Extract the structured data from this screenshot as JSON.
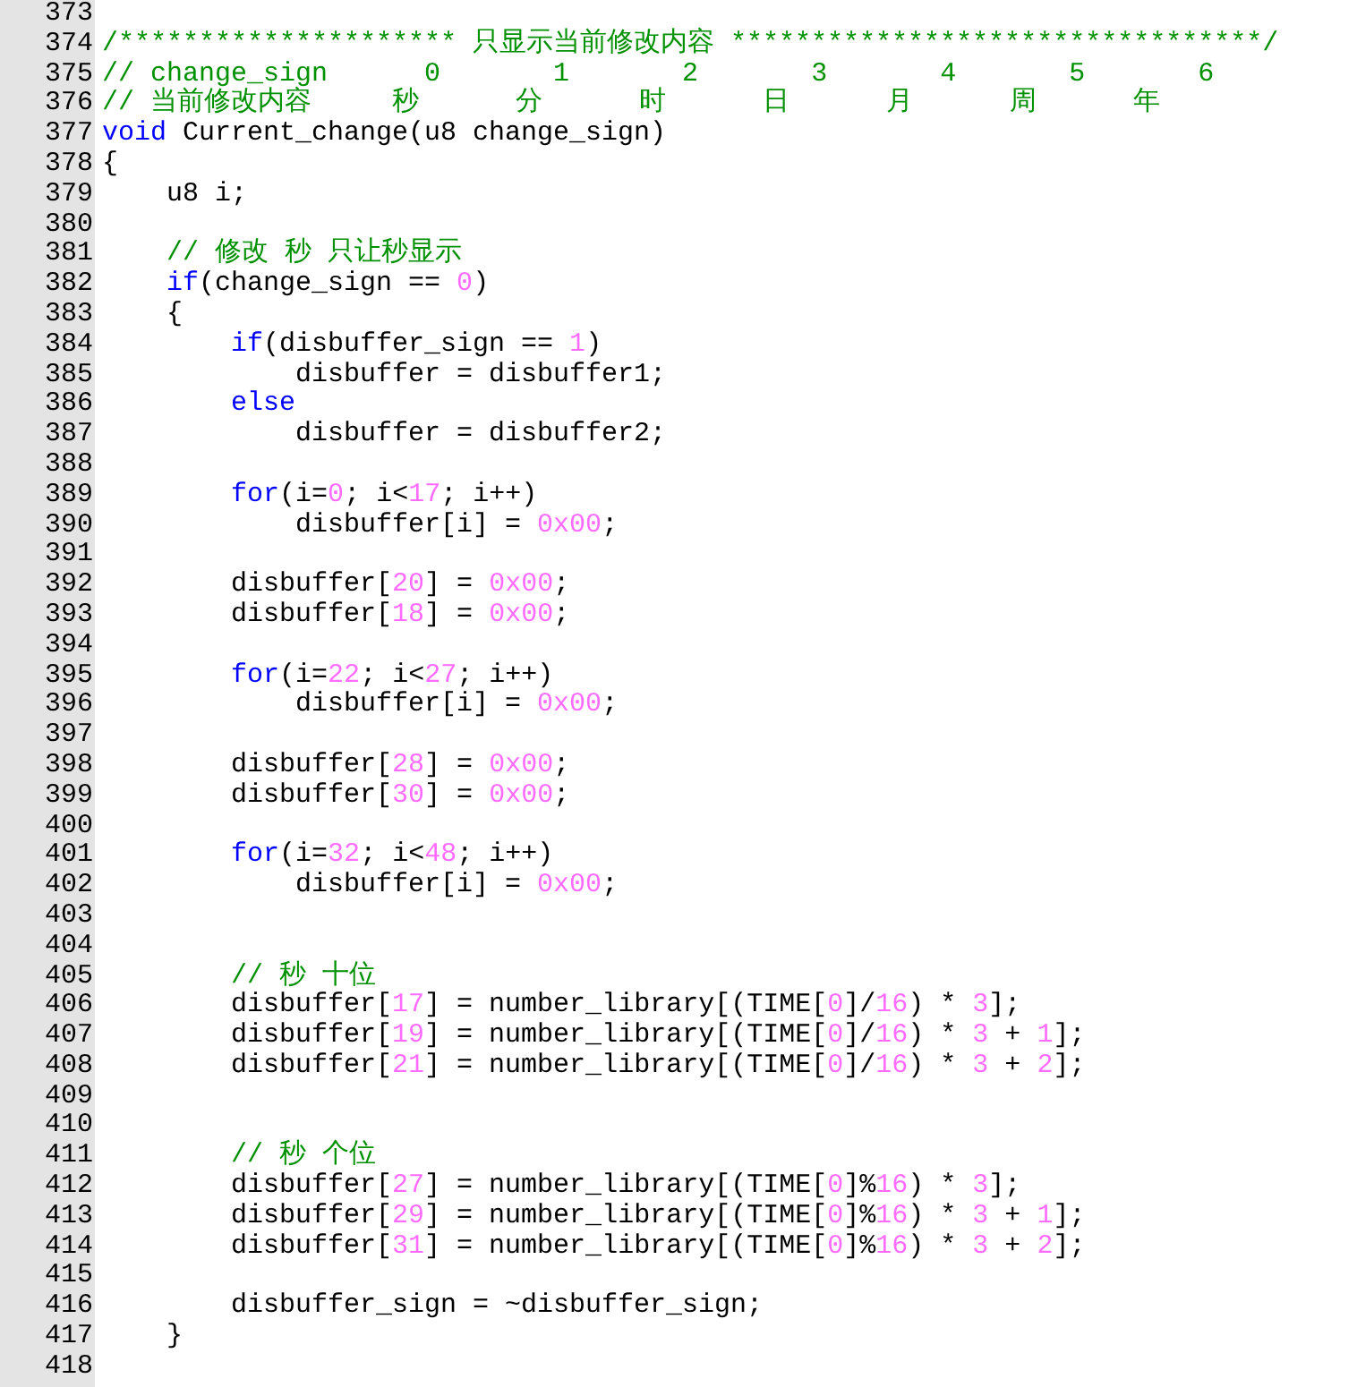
{
  "editor": {
    "lines": [
      {
        "number": "373"
      },
      {
        "number": "374",
        "tokens": [
          {
            "kind": "comment",
            "text": "/********************* 只显示当前修改内容 *********************************/"
          }
        ]
      },
      {
        "number": "375",
        "tokens": [
          {
            "kind": "comment",
            "text": "// change_sign      0       1       2       3       4       5       6"
          }
        ]
      },
      {
        "number": "376",
        "tokens": [
          {
            "kind": "comment",
            "text": "// 当前修改内容     秒      分      时      日      月      周      年"
          }
        ]
      },
      {
        "number": "377",
        "tokens": [
          {
            "kind": "keyword",
            "text": "void"
          },
          {
            "kind": "plain",
            "text": " Current_change(u8 change_sign)"
          }
        ]
      },
      {
        "number": "378",
        "tokens": [
          {
            "kind": "plain",
            "text": "{"
          }
        ]
      },
      {
        "number": "379",
        "tokens": [
          {
            "kind": "plain",
            "text": "    u8 i;"
          }
        ]
      },
      {
        "number": "380"
      },
      {
        "number": "381",
        "tokens": [
          {
            "kind": "comment",
            "text": "    // 修改 秒 只让秒显示"
          }
        ]
      },
      {
        "number": "382",
        "tokens": [
          {
            "kind": "keyword",
            "text": "    if"
          },
          {
            "kind": "plain",
            "text": "(change_sign == "
          },
          {
            "kind": "number",
            "text": "0"
          },
          {
            "kind": "plain",
            "text": ")"
          }
        ]
      },
      {
        "number": "383",
        "tokens": [
          {
            "kind": "plain",
            "text": "    {"
          }
        ]
      },
      {
        "number": "384",
        "tokens": [
          {
            "kind": "keyword",
            "text": "        if"
          },
          {
            "kind": "plain",
            "text": "(disbuffer_sign == "
          },
          {
            "kind": "number",
            "text": "1"
          },
          {
            "kind": "plain",
            "text": ")"
          }
        ]
      },
      {
        "number": "385",
        "tokens": [
          {
            "kind": "plain",
            "text": "            disbuffer = disbuffer1;"
          }
        ]
      },
      {
        "number": "386",
        "tokens": [
          {
            "kind": "keyword",
            "text": "        else"
          }
        ]
      },
      {
        "number": "387",
        "tokens": [
          {
            "kind": "plain",
            "text": "            disbuffer = disbuffer2;"
          }
        ]
      },
      {
        "number": "388"
      },
      {
        "number": "389",
        "tokens": [
          {
            "kind": "keyword",
            "text": "        for"
          },
          {
            "kind": "plain",
            "text": "(i="
          },
          {
            "kind": "number",
            "text": "0"
          },
          {
            "kind": "plain",
            "text": "; i<"
          },
          {
            "kind": "number",
            "text": "17"
          },
          {
            "kind": "plain",
            "text": "; i++)"
          }
        ]
      },
      {
        "number": "390",
        "tokens": [
          {
            "kind": "plain",
            "text": "            disbuffer[i] = "
          },
          {
            "kind": "number",
            "text": "0x00"
          },
          {
            "kind": "plain",
            "text": ";"
          }
        ]
      },
      {
        "number": "391"
      },
      {
        "number": "392",
        "tokens": [
          {
            "kind": "plain",
            "text": "        disbuffer["
          },
          {
            "kind": "number",
            "text": "20"
          },
          {
            "kind": "plain",
            "text": "] = "
          },
          {
            "kind": "number",
            "text": "0x00"
          },
          {
            "kind": "plain",
            "text": ";"
          }
        ]
      },
      {
        "number": "393",
        "tokens": [
          {
            "kind": "plain",
            "text": "        disbuffer["
          },
          {
            "kind": "number",
            "text": "18"
          },
          {
            "kind": "plain",
            "text": "] = "
          },
          {
            "kind": "number",
            "text": "0x00"
          },
          {
            "kind": "plain",
            "text": ";"
          }
        ]
      },
      {
        "number": "394"
      },
      {
        "number": "395",
        "tokens": [
          {
            "kind": "keyword",
            "text": "        for"
          },
          {
            "kind": "plain",
            "text": "(i="
          },
          {
            "kind": "number",
            "text": "22"
          },
          {
            "kind": "plain",
            "text": "; i<"
          },
          {
            "kind": "number",
            "text": "27"
          },
          {
            "kind": "plain",
            "text": "; i++)"
          }
        ]
      },
      {
        "number": "396",
        "tokens": [
          {
            "kind": "plain",
            "text": "            disbuffer[i] = "
          },
          {
            "kind": "number",
            "text": "0x00"
          },
          {
            "kind": "plain",
            "text": ";"
          }
        ]
      },
      {
        "number": "397"
      },
      {
        "number": "398",
        "tokens": [
          {
            "kind": "plain",
            "text": "        disbuffer["
          },
          {
            "kind": "number",
            "text": "28"
          },
          {
            "kind": "plain",
            "text": "] = "
          },
          {
            "kind": "number",
            "text": "0x00"
          },
          {
            "kind": "plain",
            "text": ";"
          }
        ]
      },
      {
        "number": "399",
        "tokens": [
          {
            "kind": "plain",
            "text": "        disbuffer["
          },
          {
            "kind": "number",
            "text": "30"
          },
          {
            "kind": "plain",
            "text": "] = "
          },
          {
            "kind": "number",
            "text": "0x00"
          },
          {
            "kind": "plain",
            "text": ";"
          }
        ]
      },
      {
        "number": "400"
      },
      {
        "number": "401",
        "tokens": [
          {
            "kind": "keyword",
            "text": "        for"
          },
          {
            "kind": "plain",
            "text": "(i="
          },
          {
            "kind": "number",
            "text": "32"
          },
          {
            "kind": "plain",
            "text": "; i<"
          },
          {
            "kind": "number",
            "text": "48"
          },
          {
            "kind": "plain",
            "text": "; i++)"
          }
        ]
      },
      {
        "number": "402",
        "tokens": [
          {
            "kind": "plain",
            "text": "            disbuffer[i] = "
          },
          {
            "kind": "number",
            "text": "0x00"
          },
          {
            "kind": "plain",
            "text": ";"
          }
        ]
      },
      {
        "number": "403"
      },
      {
        "number": "404"
      },
      {
        "number": "405",
        "tokens": [
          {
            "kind": "comment",
            "text": "        // 秒 十位"
          }
        ]
      },
      {
        "number": "406",
        "tokens": [
          {
            "kind": "plain",
            "text": "        disbuffer["
          },
          {
            "kind": "number",
            "text": "17"
          },
          {
            "kind": "plain",
            "text": "] = number_library[(TIME["
          },
          {
            "kind": "number",
            "text": "0"
          },
          {
            "kind": "plain",
            "text": "]/"
          },
          {
            "kind": "number",
            "text": "16"
          },
          {
            "kind": "plain",
            "text": ") * "
          },
          {
            "kind": "number",
            "text": "3"
          },
          {
            "kind": "plain",
            "text": "];"
          }
        ]
      },
      {
        "number": "407",
        "tokens": [
          {
            "kind": "plain",
            "text": "        disbuffer["
          },
          {
            "kind": "number",
            "text": "19"
          },
          {
            "kind": "plain",
            "text": "] = number_library[(TIME["
          },
          {
            "kind": "number",
            "text": "0"
          },
          {
            "kind": "plain",
            "text": "]/"
          },
          {
            "kind": "number",
            "text": "16"
          },
          {
            "kind": "plain",
            "text": ") * "
          },
          {
            "kind": "number",
            "text": "3"
          },
          {
            "kind": "plain",
            "text": " + "
          },
          {
            "kind": "number",
            "text": "1"
          },
          {
            "kind": "plain",
            "text": "];"
          }
        ]
      },
      {
        "number": "408",
        "tokens": [
          {
            "kind": "plain",
            "text": "        disbuffer["
          },
          {
            "kind": "number",
            "text": "21"
          },
          {
            "kind": "plain",
            "text": "] = number_library[(TIME["
          },
          {
            "kind": "number",
            "text": "0"
          },
          {
            "kind": "plain",
            "text": "]/"
          },
          {
            "kind": "number",
            "text": "16"
          },
          {
            "kind": "plain",
            "text": ") * "
          },
          {
            "kind": "number",
            "text": "3"
          },
          {
            "kind": "plain",
            "text": " + "
          },
          {
            "kind": "number",
            "text": "2"
          },
          {
            "kind": "plain",
            "text": "];"
          }
        ]
      },
      {
        "number": "409"
      },
      {
        "number": "410"
      },
      {
        "number": "411",
        "tokens": [
          {
            "kind": "comment",
            "text": "        // 秒 个位"
          }
        ]
      },
      {
        "number": "412",
        "tokens": [
          {
            "kind": "plain",
            "text": "        disbuffer["
          },
          {
            "kind": "number",
            "text": "27"
          },
          {
            "kind": "plain",
            "text": "] = number_library[(TIME["
          },
          {
            "kind": "number",
            "text": "0"
          },
          {
            "kind": "plain",
            "text": "]%"
          },
          {
            "kind": "number",
            "text": "16"
          },
          {
            "kind": "plain",
            "text": ") * "
          },
          {
            "kind": "number",
            "text": "3"
          },
          {
            "kind": "plain",
            "text": "];"
          }
        ]
      },
      {
        "number": "413",
        "tokens": [
          {
            "kind": "plain",
            "text": "        disbuffer["
          },
          {
            "kind": "number",
            "text": "29"
          },
          {
            "kind": "plain",
            "text": "] = number_library[(TIME["
          },
          {
            "kind": "number",
            "text": "0"
          },
          {
            "kind": "plain",
            "text": "]%"
          },
          {
            "kind": "number",
            "text": "16"
          },
          {
            "kind": "plain",
            "text": ") * "
          },
          {
            "kind": "number",
            "text": "3"
          },
          {
            "kind": "plain",
            "text": " + "
          },
          {
            "kind": "number",
            "text": "1"
          },
          {
            "kind": "plain",
            "text": "];"
          }
        ]
      },
      {
        "number": "414",
        "tokens": [
          {
            "kind": "plain",
            "text": "        disbuffer["
          },
          {
            "kind": "number",
            "text": "31"
          },
          {
            "kind": "plain",
            "text": "] = number_library[(TIME["
          },
          {
            "kind": "number",
            "text": "0"
          },
          {
            "kind": "plain",
            "text": "]%"
          },
          {
            "kind": "number",
            "text": "16"
          },
          {
            "kind": "plain",
            "text": ") * "
          },
          {
            "kind": "number",
            "text": "3"
          },
          {
            "kind": "plain",
            "text": " + "
          },
          {
            "kind": "number",
            "text": "2"
          },
          {
            "kind": "plain",
            "text": "];"
          }
        ]
      },
      {
        "number": "415"
      },
      {
        "number": "416",
        "tokens": [
          {
            "kind": "plain",
            "text": "        disbuffer_sign = ~disbuffer_sign;"
          }
        ]
      },
      {
        "number": "417",
        "tokens": [
          {
            "kind": "plain",
            "text": "    }"
          }
        ]
      },
      {
        "number": "418"
      }
    ]
  }
}
